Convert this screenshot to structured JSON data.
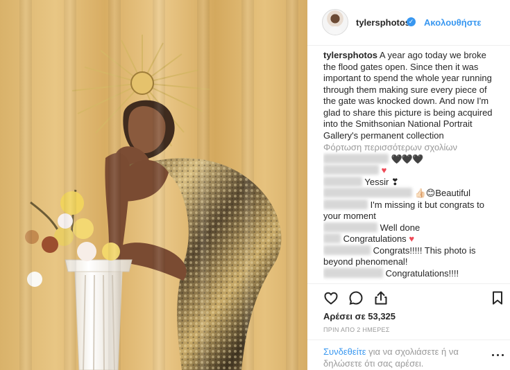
{
  "post": {
    "username": "tylersphotos",
    "follow_label": "Ακολουθήστε",
    "caption_text": "A year ago today we broke the flood gates open. Since then it was important to spend the whole year running through them making sure every piece of the gate was knocked down. And now I'm glad to share this picture is being acquired into the Smithsonian National Portrait Gallery's permanent collection",
    "load_more": "Φόρτωση περισσότερων σχολίων",
    "comments": [
      {
        "text": "🖤🖤🖤"
      },
      {
        "text": ""
      },
      {
        "text": "Yessir ❣"
      },
      {
        "text": "👍🏻😊Beautiful"
      },
      {
        "text": "I'm missing it but congrats to your moment"
      },
      {
        "text": "Well done"
      },
      {
        "text": "Congratulations"
      },
      {
        "text": "Congrats!!!!! This photo is beyond phenomenal!"
      },
      {
        "text": "Congratulations!!!!"
      }
    ],
    "likes": "Αρέσει σε 53,325",
    "timestamp": "ΠΡΙΝ ΑΠΟ 2 ΗΜΕΡΕΣ",
    "login_link": "Συνδεθείτε",
    "login_text": " για να σχολιάσετε ή να δηλώσετε ότι σας αρέσει."
  },
  "icons": {
    "verified": "verified-badge-icon",
    "like": "heart-icon",
    "comment": "comment-icon",
    "share": "share-icon",
    "save": "bookmark-icon",
    "more": "more-options-icon"
  },
  "colors": {
    "accent": "#3897f0",
    "heart": "#ed4956",
    "muted": "#999999"
  }
}
